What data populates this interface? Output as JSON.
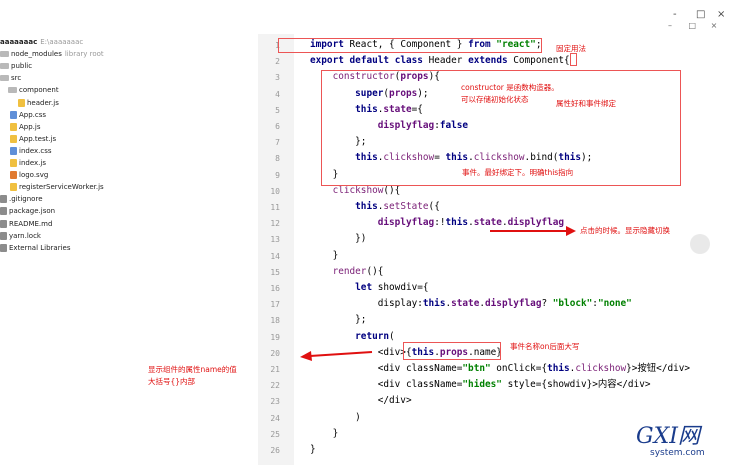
{
  "window": {
    "controls": [
      "-",
      "□",
      "×"
    ]
  },
  "sidebar": {
    "items": [
      {
        "label": "aaaaaaac",
        "sub": "E:\\aaaaaaac",
        "type": "root"
      },
      {
        "label": "node_modules",
        "sub": "library root",
        "type": "folder"
      },
      {
        "label": "public",
        "sub": "",
        "type": "folder"
      },
      {
        "label": "src",
        "sub": "",
        "type": "folder"
      },
      {
        "label": "component",
        "sub": "",
        "type": "folder"
      },
      {
        "label": "header.js",
        "sub": "",
        "type": "js"
      },
      {
        "label": "App.css",
        "sub": "",
        "type": "css"
      },
      {
        "label": "App.js",
        "sub": "",
        "type": "js"
      },
      {
        "label": "App.test.js",
        "sub": "",
        "type": "js"
      },
      {
        "label": "index.css",
        "sub": "",
        "type": "css"
      },
      {
        "label": "index.js",
        "sub": "",
        "type": "js"
      },
      {
        "label": "logo.svg",
        "sub": "",
        "type": "svg"
      },
      {
        "label": "registerServiceWorker.js",
        "sub": "",
        "type": "js"
      },
      {
        "label": ".gitignore",
        "sub": "",
        "type": "file"
      },
      {
        "label": "package.json",
        "sub": "",
        "type": "file"
      },
      {
        "label": "README.md",
        "sub": "",
        "type": "file"
      },
      {
        "label": "yarn.lock",
        "sub": "",
        "type": "file"
      },
      {
        "label": "External Libraries",
        "sub": "",
        "type": "lib"
      }
    ]
  },
  "editor": {
    "lines": [
      "import React, { Component } from \"react\";",
      "export default class Header extends Component{",
      "    constructor(props){",
      "        super(props);",
      "        this.state={",
      "            displyflag:false",
      "        };",
      "        this.clickshow= this.clickshow.bind(this);",
      "    }",
      "    clickshow(){",
      "        this.setState({",
      "            displyflag:!this.state.displyflag",
      "        })",
      "    }",
      "    render(){",
      "        let showdiv={",
      "            display:this.state.displyflag? \"block\":\"none\"",
      "        };",
      "        return(",
      "            <div>{this.props.name}",
      "            <div className=\"btn\" onClick={this.clickshow}>按钮</div>",
      "            <div className=\"hides\" style={showdiv}>内容</div>",
      "            </div>",
      "        )",
      "    }",
      "}"
    ]
  },
  "annotations": {
    "fixed_usage": "固定用法",
    "constructor_note_1": "constructor 是函数构造器。",
    "constructor_note_2": "可以存储初始化状态",
    "props_events": "属性好和事件绑定",
    "events_bind": "事件。最好绑定下。明确this指向",
    "toggle_on_click": "点击的时候。显示隐藏切换",
    "event_name_case": "事件名称on后面大写",
    "show_name_1": "显示组件的属性name的值",
    "show_name_2": "大括号{}内部"
  },
  "watermark": {
    "brand": "GXI网",
    "domain": "system.com"
  },
  "colors": {
    "annotation": "#e01010",
    "keyword": "#000080",
    "string": "#008000",
    "gutter": "#f3f3f3"
  }
}
